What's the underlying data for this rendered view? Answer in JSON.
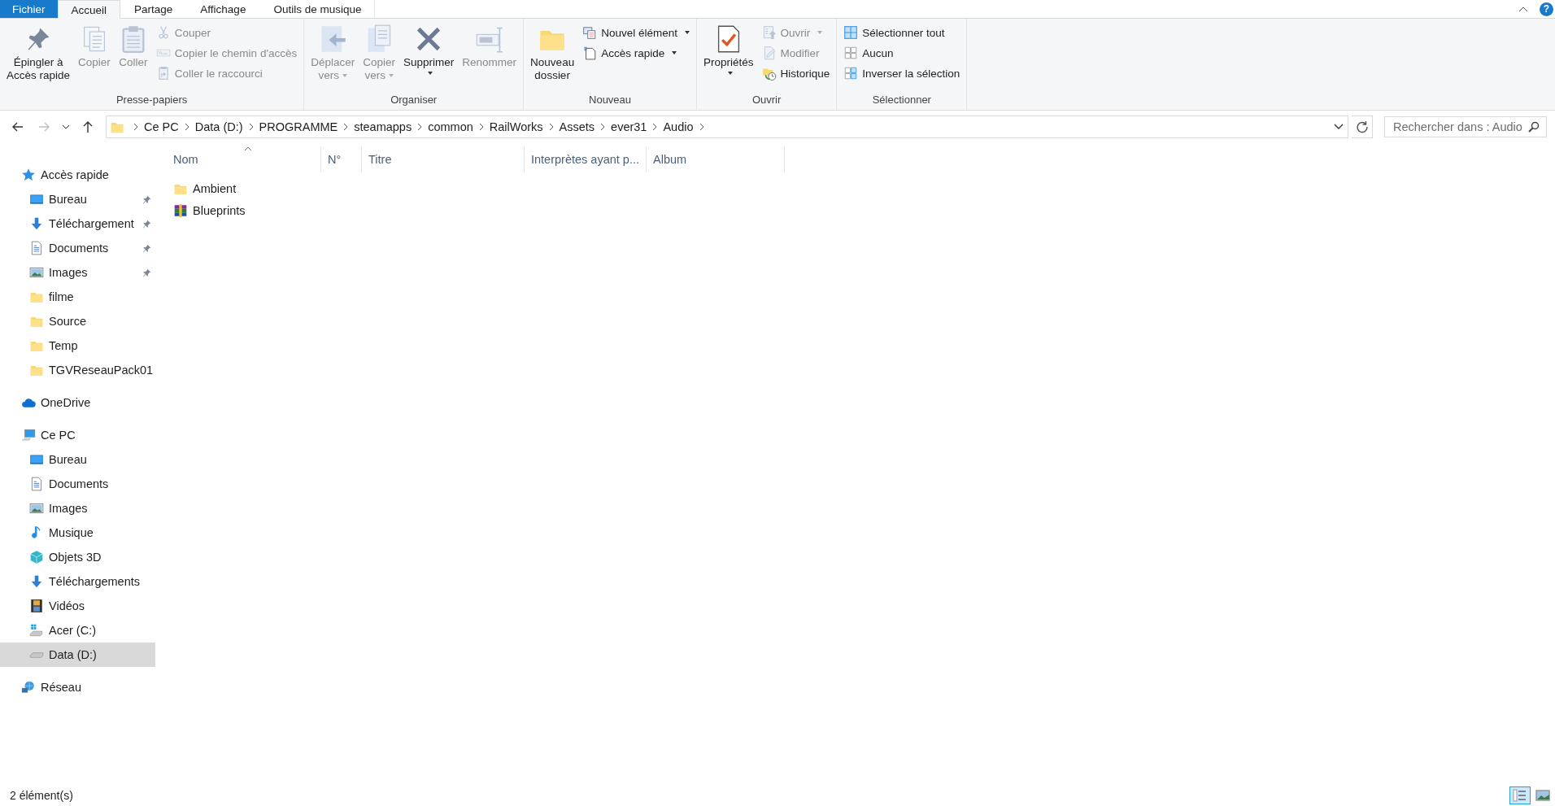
{
  "tabs": [
    {
      "label": "Fichier",
      "kind": "file",
      "selected": false
    },
    {
      "label": "Accueil",
      "kind": "tab",
      "selected": true
    },
    {
      "label": "Partage",
      "kind": "tab",
      "selected": false
    },
    {
      "label": "Affichage",
      "kind": "tab",
      "selected": false
    },
    {
      "label": "Outils de musique",
      "kind": "tab",
      "selected": false
    }
  ],
  "help": "?",
  "ribbon": {
    "groups": [
      {
        "label": "Presse-papiers",
        "items": [
          {
            "label": "Épingler à\nAccès rapide",
            "kind": "pin",
            "disabled": false,
            "dropdown": false
          },
          {
            "label": "Copier",
            "kind": "copy",
            "disabled": true,
            "dropdown": false
          },
          {
            "label": "Coller",
            "kind": "paste",
            "disabled": true,
            "dropdown": false
          },
          {
            "stack": [
              {
                "label": "Couper",
                "kind": "cut",
                "disabled": true,
                "dropdown": false
              },
              {
                "label": "Copier le chemin d'accès",
                "kind": "path",
                "disabled": true,
                "dropdown": false
              },
              {
                "label": "Coller le raccourci",
                "kind": "shortcut",
                "disabled": true,
                "dropdown": false
              }
            ]
          }
        ]
      },
      {
        "label": "Organiser",
        "items": [
          {
            "label": "Déplacer\nvers",
            "kind": "move",
            "disabled": true,
            "dropdown": true
          },
          {
            "label": "Copier\nvers",
            "kind": "copyto",
            "disabled": true,
            "dropdown": true
          },
          {
            "label": "Supprimer",
            "kind": "delete",
            "disabled": false,
            "dropdown": true
          },
          {
            "label": "Renommer",
            "kind": "rename",
            "disabled": true,
            "dropdown": false
          }
        ]
      },
      {
        "label": "Nouveau",
        "items": [
          {
            "label": "Nouveau\ndossier",
            "kind": "folder",
            "disabled": false,
            "dropdown": false
          },
          {
            "stack": [
              {
                "label": "Nouvel élément",
                "kind": "newitem",
                "disabled": false,
                "dropdown": true
              },
              {
                "label": "Accès rapide",
                "kind": "easyaccess",
                "disabled": false,
                "dropdown": true
              }
            ]
          }
        ]
      },
      {
        "label": "Ouvrir",
        "items": [
          {
            "label": "Propriétés",
            "kind": "properties",
            "disabled": false,
            "dropdown": true
          },
          {
            "stack": [
              {
                "label": "Ouvrir",
                "kind": "open",
                "disabled": true,
                "dropdown": true
              },
              {
                "label": "Modifier",
                "kind": "edit",
                "disabled": true,
                "dropdown": false
              },
              {
                "label": "Historique",
                "kind": "history",
                "disabled": false,
                "dropdown": false
              }
            ]
          }
        ]
      },
      {
        "label": "Sélectionner",
        "items": [
          {
            "stack": [
              {
                "label": "Sélectionner tout",
                "kind": "selectall",
                "disabled": false,
                "dropdown": false
              },
              {
                "label": "Aucun",
                "kind": "selectnone",
                "disabled": false,
                "dropdown": false
              },
              {
                "label": "Inverser la sélection",
                "kind": "invert",
                "disabled": false,
                "dropdown": false
              }
            ]
          }
        ]
      }
    ]
  },
  "address_bar": {
    "back_disabled": false,
    "forward_disabled": true,
    "path": [
      "Ce PC",
      "Data (D:)",
      "PROGRAMME",
      "steamapps",
      "common",
      "RailWorks",
      "Assets",
      "ever31",
      "Audio"
    ]
  },
  "search": {
    "placeholder": "Rechercher dans : Audio"
  },
  "navigation": [
    {
      "label": "Accès rapide",
      "kind": "star",
      "selected": false,
      "children": [
        {
          "label": "Bureau",
          "kind": "desktop",
          "pinned": true,
          "selected": false
        },
        {
          "label": "Téléchargement",
          "kind": "download",
          "pinned": true,
          "selected": false
        },
        {
          "label": "Documents",
          "kind": "document",
          "pinned": true,
          "selected": false
        },
        {
          "label": "Images",
          "kind": "picture",
          "pinned": true,
          "selected": false
        },
        {
          "label": "filme",
          "kind": "folder",
          "pinned": false,
          "selected": false
        },
        {
          "label": "Source",
          "kind": "folder",
          "pinned": false,
          "selected": false
        },
        {
          "label": "Temp",
          "kind": "folder",
          "pinned": false,
          "selected": false
        },
        {
          "label": "TGVReseauPack01",
          "kind": "folder",
          "pinned": false,
          "selected": false
        }
      ]
    },
    {
      "label": "OneDrive",
      "kind": "cloud",
      "selected": false
    },
    {
      "label": "Ce PC",
      "kind": "computer",
      "selected": false,
      "children": [
        {
          "label": "Bureau",
          "kind": "desktop",
          "selected": false
        },
        {
          "label": "Documents",
          "kind": "document",
          "selected": false
        },
        {
          "label": "Images",
          "kind": "picture",
          "selected": false
        },
        {
          "label": "Musique",
          "kind": "music",
          "selected": false
        },
        {
          "label": "Objets 3D",
          "kind": "cube",
          "selected": false
        },
        {
          "label": "Téléchargements",
          "kind": "download",
          "selected": false
        },
        {
          "label": "Vidéos",
          "kind": "film",
          "selected": false
        },
        {
          "label": "Acer (C:)",
          "kind": "windrive",
          "selected": false
        },
        {
          "label": "Data (D:)",
          "kind": "drive",
          "selected": true
        }
      ]
    },
    {
      "label": "Réseau",
      "kind": "network",
      "selected": false
    }
  ],
  "file_list": {
    "columns": [
      {
        "label": "Nom",
        "sorted": true
      },
      {
        "label": "N°",
        "sorted": false
      },
      {
        "label": "Titre",
        "sorted": false
      },
      {
        "label": "Interprètes ayant p...",
        "sorted": false
      },
      {
        "label": "Album",
        "sorted": false
      }
    ],
    "rows": [
      {
        "name": "Ambient",
        "kind": "folder"
      },
      {
        "name": "Blueprints",
        "kind": "archive"
      }
    ]
  },
  "status_bar": {
    "count": "2 élément(s)",
    "views": [
      {
        "kind": "details",
        "selected": true
      },
      {
        "kind": "tiles",
        "selected": false
      }
    ]
  }
}
